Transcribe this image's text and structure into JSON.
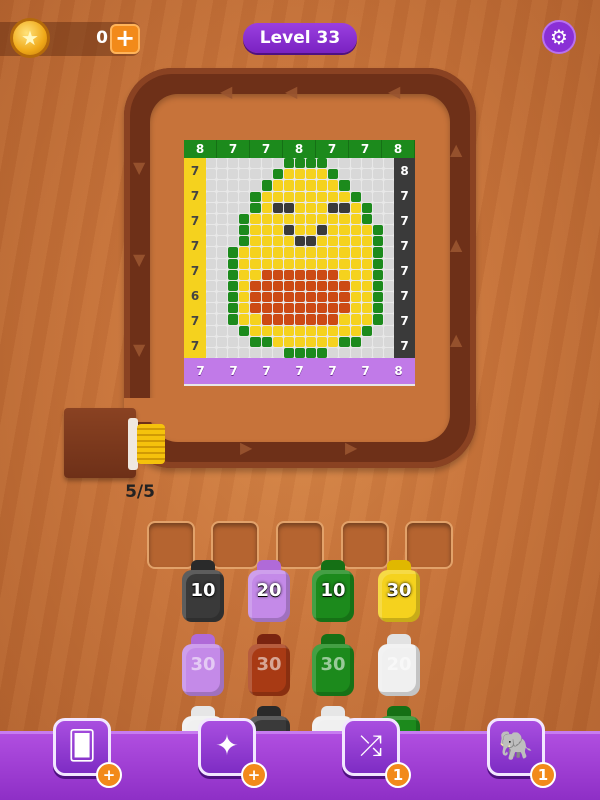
{
  "header": {
    "coins": "0",
    "coin_plus": "+",
    "level_label": "Level 33",
    "settings_icon": "gear-icon"
  },
  "colors": {
    "green": "#1c8a1c",
    "yellow": "#f5d21e",
    "black": "#3a3a3a",
    "purple": "#c17ae8",
    "red": "#a83a14",
    "white": "#f0f0f0",
    "orange_fill": "#cc4a14"
  },
  "board": {
    "col_top": [
      "8",
      "7",
      "7",
      "8",
      "7",
      "7",
      "8"
    ],
    "row_left": [
      "7",
      "7",
      "7",
      "7",
      "7",
      "6",
      "7",
      "7"
    ],
    "row_right": [
      "8",
      "7",
      "7",
      "7",
      "7",
      "7",
      "7",
      "7"
    ],
    "col_bottom": [
      "7",
      "7",
      "7",
      "7",
      "7",
      "7",
      "8"
    ]
  },
  "dispenser": {
    "count": "5/5"
  },
  "slots": [
    "",
    "",
    "",
    "",
    ""
  ],
  "bottles": [
    {
      "value": "10",
      "color": "black"
    },
    {
      "value": "20",
      "color": "purple"
    },
    {
      "value": "10",
      "color": "green"
    },
    {
      "value": "30",
      "color": "yellow"
    },
    {
      "value": "30",
      "color": "purple"
    },
    {
      "value": "30",
      "color": "red"
    },
    {
      "value": "30",
      "color": "green"
    },
    {
      "value": "20",
      "color": "white"
    }
  ],
  "boosters": [
    {
      "icon": "add-cards-icon",
      "badge": "+"
    },
    {
      "icon": "magic-wand-icon",
      "badge": "+"
    },
    {
      "icon": "shuffle-icon",
      "badge": "1"
    },
    {
      "icon": "elephant-icon",
      "badge": "1"
    }
  ]
}
